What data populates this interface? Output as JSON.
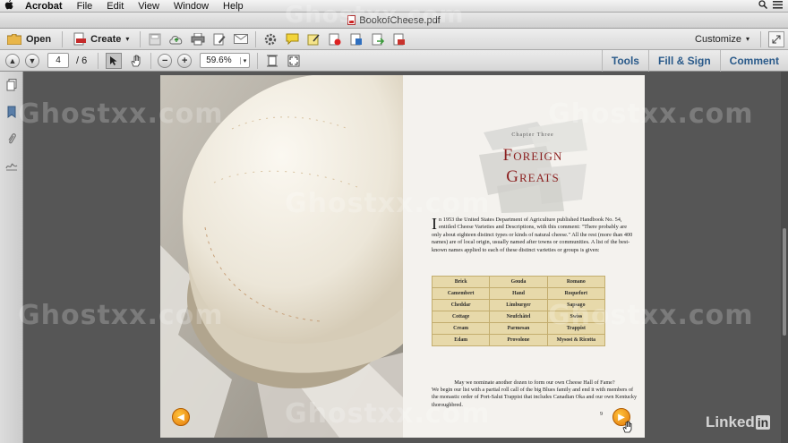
{
  "menubar": {
    "app": "Acrobat",
    "items": [
      "File",
      "Edit",
      "View",
      "Window",
      "Help"
    ]
  },
  "window": {
    "title": "BookofCheese.pdf"
  },
  "toolbar": {
    "open_label": "Open",
    "create_label": "Create",
    "customize_label": "Customize"
  },
  "navbar": {
    "current_page": "4",
    "total_pages": "/ 6",
    "zoom": "59.6%",
    "tools_label": "Tools",
    "fill_sign_label": "Fill & Sign",
    "comment_label": "Comment"
  },
  "page": {
    "chapter_label": "Chapter Three",
    "chapter_title_1": "Foreign",
    "chapter_title_2": "Greats",
    "intro_dropcap": "I",
    "intro_text": "n 1953 the United States Department of Agriculture published Handbook No. 54, entitled Cheese Varieties and Descriptions, with this comment: \"There probably are only about eighteen distinct types or kinds of natural cheese.\" All the rest (more than 400 names) are of local origin, usually named after towns or communities. A list of the best-known names applied to each of these distinct varieties or groups is given:",
    "cheese_table": [
      [
        "Brick",
        "Gouda",
        "Romano"
      ],
      [
        "Camembert",
        "Hand",
        "Roquefort"
      ],
      [
        "Cheddar",
        "Limburger",
        "Sapsago"
      ],
      [
        "Cottage",
        "Neufchâtel",
        "Swiss"
      ],
      [
        "Cream",
        "Parmesan",
        "Trappist"
      ],
      [
        "Edam",
        "Provolone",
        "Mysost & Ricotta"
      ]
    ],
    "outro_line1": "May we nominate another dozen to form our own Cheese Hall of Fame?",
    "outro_text": "We begin our list with a partial roll call of the big Blues family and end it with members of the monastic order of Port-Salut Trappist that includes Canadian Oka and our own Kentucky thoroughbred.",
    "page_number": "9"
  },
  "watermark_text": "Ghostxx.com",
  "linkedin": {
    "text": "Linked",
    "badge": "in"
  },
  "colors": {
    "accent_link": "#2a5a8a",
    "chapter_red": "#8b1f1f",
    "table_bg": "#e7d9aa",
    "nav_orange": "#f0a020"
  }
}
